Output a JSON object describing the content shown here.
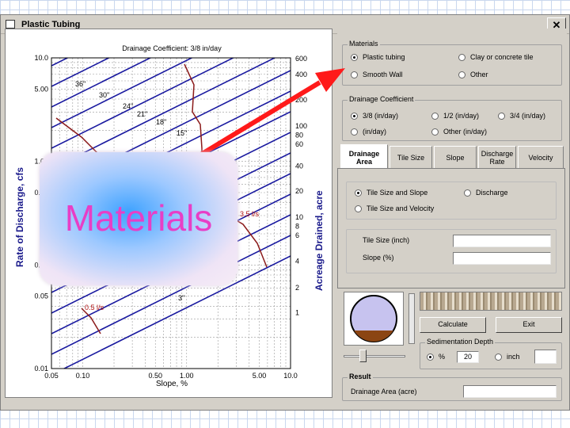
{
  "window": {
    "title": "Plastic Tubing",
    "close_label": "✕"
  },
  "chart": {
    "title": "Drainage Coefficient: 3/8 in/day",
    "y_left_label": "Rate of Discharge, cfs",
    "y_right_label": "Acreage Drained, acre",
    "x_label": "Slope, %",
    "x_ticks": [
      "0.05",
      "0.10",
      "0.50",
      "1.00",
      "5.00",
      "10.0"
    ],
    "y_left_ticks": [
      "10.0",
      "5.00",
      "1.00",
      "0.50",
      "0.10",
      "0.05",
      "0.01"
    ],
    "y_right_ticks": [
      "600",
      "400",
      "200",
      "100",
      "80",
      "60",
      "40",
      "20",
      "10",
      "8",
      "6",
      "4",
      "2",
      "1"
    ],
    "pipe_labels": [
      "36\"",
      "30\"",
      "24\"",
      "21\"",
      "18\"",
      "15\"",
      "3\""
    ],
    "velocity_labels": [
      "3.5 l/s",
      "0.5 l/s"
    ]
  },
  "overlay": {
    "text": "Materials"
  },
  "materials": {
    "legend": "Materials",
    "options": [
      {
        "label": "Plastic tubing",
        "selected": true
      },
      {
        "label": "Clay or concrete tile",
        "selected": false
      },
      {
        "label": "Smooth Wall",
        "selected": false
      },
      {
        "label": "Other",
        "selected": false
      }
    ]
  },
  "drainage_coefficient": {
    "legend": "Drainage Coefficient",
    "options": [
      {
        "label": "3/8 (in/day)",
        "selected": true
      },
      {
        "label": "1/2 (in/day)",
        "selected": false
      },
      {
        "label": "3/4 (in/day)",
        "selected": false
      },
      {
        "label": "(in/day)",
        "selected": false
      },
      {
        "label": "Other (in/day)",
        "selected": false
      }
    ]
  },
  "tabs": [
    {
      "label": "Drainage Area",
      "active": true
    },
    {
      "label": "Tile Size",
      "active": false
    },
    {
      "label": "Slope",
      "active": false
    },
    {
      "label": "Discharge Rate",
      "active": false
    },
    {
      "label": "Velocity",
      "active": false
    }
  ],
  "tab_area": {
    "options": [
      {
        "label": "Tile Size and Slope",
        "selected": true
      },
      {
        "label": "Discharge",
        "selected": false
      },
      {
        "label": "Tile Size and Velocity",
        "selected": false
      }
    ],
    "tile_size_label": "Tile Size (inch)",
    "tile_size_value": "",
    "slope_label": "Slope (%)",
    "slope_value": ""
  },
  "buttons": {
    "calculate": "Calculate",
    "exit": "Exit"
  },
  "sedimentation": {
    "legend": "Sedimentation Depth",
    "percent_label": "%",
    "percent_value": "20",
    "inch_label": "inch",
    "inch_value": "",
    "percent_selected": true
  },
  "result": {
    "legend": "Result",
    "label": "Drainage Area (acre)",
    "value": ""
  }
}
